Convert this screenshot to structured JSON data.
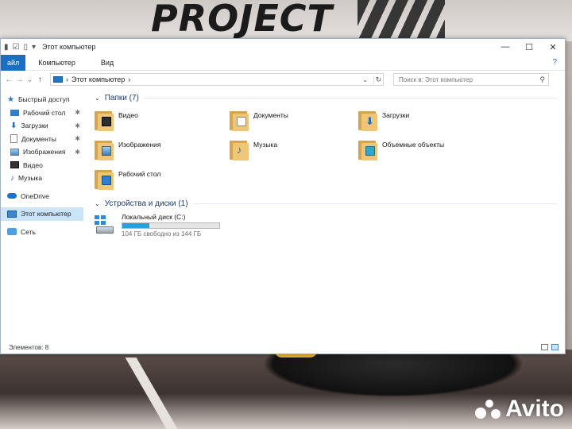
{
  "wallpaper": {
    "logo_text": "PROJECT",
    "watermark": "Avito"
  },
  "window": {
    "title": "Этот компьютер",
    "controls": {
      "minimize": "—",
      "maximize": "☐",
      "close": "✕"
    }
  },
  "ribbon": {
    "file_tab": "айл",
    "tabs": [
      "Компьютер",
      "Вид"
    ],
    "help": "?"
  },
  "address": {
    "path": "Этот компьютер",
    "search_placeholder": "Поиск в: Этот компьютер"
  },
  "sidebar": {
    "items": [
      {
        "label": "Быстрый доступ",
        "icon": "star-icon"
      },
      {
        "label": "Рабочий стол",
        "icon": "desktop-icon",
        "pinned": true
      },
      {
        "label": "Загрузки",
        "icon": "download-icon",
        "pinned": true
      },
      {
        "label": "Документы",
        "icon": "document-icon",
        "pinned": true
      },
      {
        "label": "Изображения",
        "icon": "image-icon",
        "pinned": true
      },
      {
        "label": "Видео",
        "icon": "video-icon"
      },
      {
        "label": "Музыка",
        "icon": "music-icon"
      },
      {
        "label": "OneDrive",
        "icon": "cloud-icon"
      },
      {
        "label": "Этот компьютер",
        "icon": "computer-icon",
        "selected": true
      },
      {
        "label": "Сеть",
        "icon": "network-icon"
      }
    ]
  },
  "folders_group": {
    "heading": "Папки (7)",
    "items": [
      {
        "label": "Видео",
        "icon": "video-folder-icon"
      },
      {
        "label": "Документы",
        "icon": "documents-folder-icon"
      },
      {
        "label": "Загрузки",
        "icon": "downloads-folder-icon"
      },
      {
        "label": "Изображения",
        "icon": "pictures-folder-icon"
      },
      {
        "label": "Музыка",
        "icon": "music-folder-icon"
      },
      {
        "label": "Объемные объекты",
        "icon": "3d-objects-folder-icon"
      },
      {
        "label": "Рабочий стол",
        "icon": "desktop-folder-icon"
      }
    ]
  },
  "drives_group": {
    "heading": "Устройства и диски (1)",
    "items": [
      {
        "label": "Локальный диск (C:)",
        "free_text": "104 ГБ свободно из 144 ГБ",
        "used_fraction": 0.28
      }
    ]
  },
  "status": {
    "items_count": "Элементов: 8"
  },
  "colors": {
    "accent": "#1a6fc4",
    "selection": "#cce4f7",
    "drive_bar": "#26a0da"
  }
}
